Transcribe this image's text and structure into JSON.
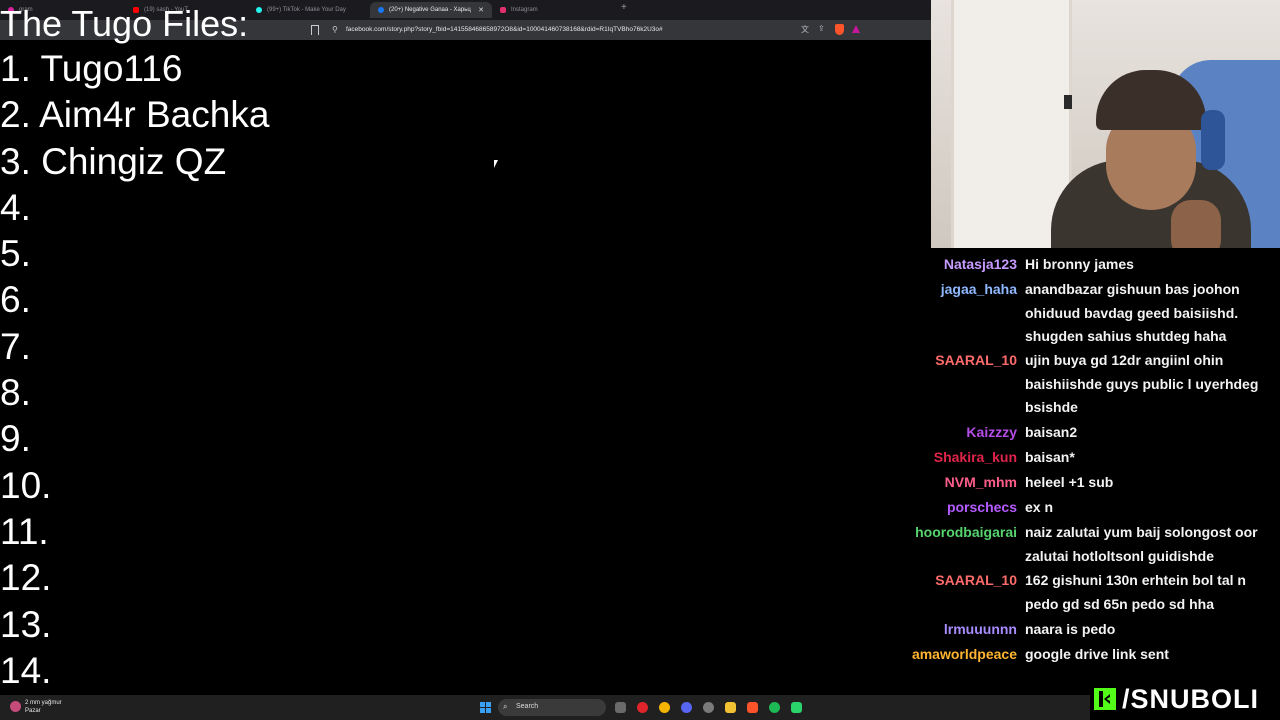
{
  "browser": {
    "tabs": [
      {
        "title": "gram",
        "favicon_color": "#d6249f"
      },
      {
        "title": "(19) sash - YouT",
        "favicon_color": "#ff0000"
      },
      {
        "title": "(99+) TikTok - Make Your Day",
        "favicon_color": "#25f4ee"
      },
      {
        "title": "(20+) Negative Ganaa - Харьц",
        "favicon_color": "#1877f2",
        "active": true
      },
      {
        "title": "Instagram",
        "favicon_color": "#e1306c"
      }
    ],
    "new_tab": "+",
    "url": "facebook.com/story.php?story_fbid=141558468658972O8&id=100041460738168&rdid=R1IqTVBho76k2U3o#"
  },
  "overlay": {
    "title": "The Tugo Files:",
    "items": [
      "1. Tugo116",
      "2. Aim4r Bachka",
      "3. Chingiz QZ",
      "4.",
      "5.",
      "6.",
      "7.",
      "8.",
      "9.",
      "10.",
      "11.",
      "12.",
      "13.",
      "14."
    ]
  },
  "chat": {
    "messages": [
      {
        "user": "Natasja123",
        "color": "#c79bff",
        "text": "Hi bronny james"
      },
      {
        "user": "jagaa_haha",
        "color": "#8fb8ff",
        "text": "anandbazar gishuun bas joohon ohiduud bavdag geed baisiishd. shugden sahius shutdeg haha"
      },
      {
        "user": "SAARAL_10",
        "color": "#ff6b6b",
        "text": "ujin buya gd 12dr angiinl ohin baishiishde guys public l uyerhdeg bsishde"
      },
      {
        "user": "Kaizzzy",
        "color": "#b54ee8",
        "text": "baisan2"
      },
      {
        "user": "Shakira_kun",
        "color": "#e0244a",
        "text": "baisan*"
      },
      {
        "user": "NVM_mhm",
        "color": "#ff5d8a",
        "text": "heleel +1 sub"
      },
      {
        "user": "porschecs",
        "color": "#b45cff",
        "text": "ex n"
      },
      {
        "user": "hoorodbaigarai",
        "color": "#56d36e",
        "text": "naiz zalutai yum baij solongost oor zalutai hotloltsonl guidishde"
      },
      {
        "user": "SAARAL_10",
        "color": "#ff6b6b",
        "text": "162 gishuni 130n erhtein bol tal n pedo gd sd 65n pedo sd hha"
      },
      {
        "user": "lrmuuunnn",
        "color": "#a78cff",
        "text": "naara is pedo"
      },
      {
        "user": "amaworldpeace",
        "color": "#ffb432",
        "text": "google drive link sent"
      }
    ]
  },
  "brand": {
    "name": "/SNUBOLI",
    "accent": "#53fc18"
  },
  "taskbar": {
    "weather_line1": "2 mm yağmur",
    "weather_line2": "Pazar",
    "search_label": "Search"
  }
}
